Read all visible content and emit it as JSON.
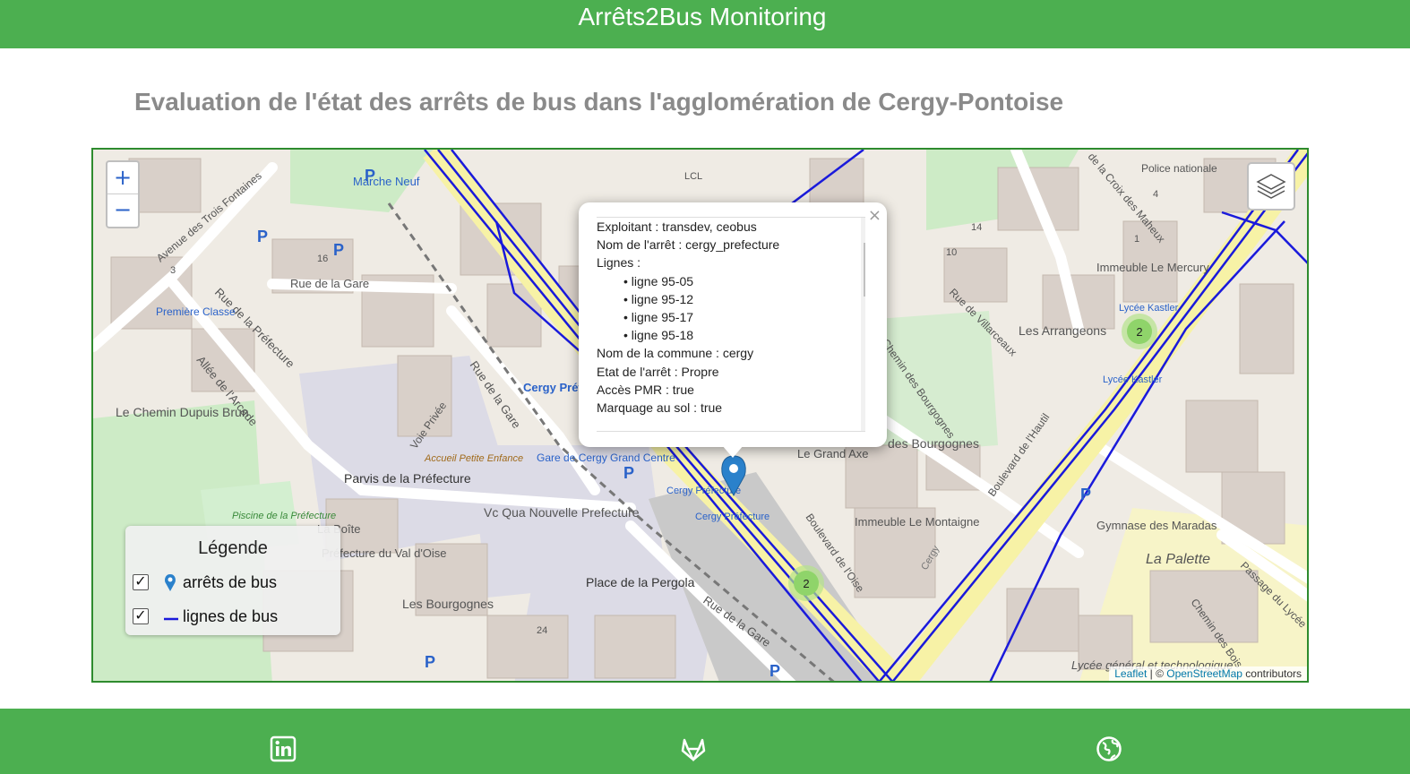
{
  "header": {
    "title": "Arrêts2Bus Monitoring"
  },
  "page": {
    "heading": "Evaluation de l'état des arrêts de bus dans l'agglomération de Cergy-Pontoise"
  },
  "map": {
    "zoom_in": "+",
    "zoom_out": "−",
    "labels": {
      "marche_neuf": "Marche Neuf",
      "lcl": "LCL",
      "police": "Police nationale",
      "rue_de_la_gare": "Rue de la Gare",
      "avenue_trois_fontaines": "Avenue des Trois Fontaines",
      "rue_prefecture": "Rue de la Préfecture",
      "premiere_classe": "Première Classe",
      "allee_arcade": "Allée de l'Arcade",
      "le_chemin_dupuis_brun": "Le Chemin Dupuis Brun",
      "parvis": "Parvis de la Préfecture",
      "voie_privee": "Voie Privée",
      "rue_de_la_gare_2": "Rue de la Gare",
      "cergy_prefecture": "Cergy Préfecture",
      "accueil": "Accueil Petite Enfance",
      "gare_cergy": "Gare de Cergy Grand Centre",
      "vc_qua": "Vc Qua Nouvelle Prefecture",
      "la_boite": "La Boîte",
      "prefecture_val_oise": "Préfecture du Val d'Oise",
      "piscine": "Piscine de la Préfecture",
      "les_bourgognes": "Les Bourgognes",
      "place_pergola": "Place de la Pergola",
      "rue_de_la_gare_3": "Rue de la Gare",
      "cergy_prefecture_stop1": "Cergy Préfecture",
      "cergy_prefecture_stop2": "Cergy Préfecture",
      "boulevard_oise": "Boulevard de l'Oise",
      "le_grand_axe": "Le Grand Axe",
      "immeuble_montaigne": "Immeuble Le Montaigne",
      "des_bourgognes": "des Bourgognes",
      "chemin_bourgognes": "Chemin des Bourgognes",
      "rue_villarceaux": "Rue de Villarceaux",
      "les_arrangeons": "Les Arrangeons",
      "immeuble_mercury": "Immeuble Le Mercury",
      "lycee_kastler": "Lycée Kastler",
      "lycee_kastler_2": "Lycée Kastler",
      "croix_maheux": "de la Croix des Maheux",
      "boulevard_hautil": "Boulevard de l'Hautil",
      "gymnase": "Gymnase des Maradas",
      "la_palette": "La Palette",
      "passage_lycee": "Passage du Lycée",
      "chemin_des_bois": "Chemin des Bois",
      "lycee_general": "Lycée général et technologique",
      "cergy": "Cergy",
      "num_16": "16",
      "num_14": "14",
      "num_10": "10",
      "num_24": "24",
      "num_3": "3",
      "num_4": "4",
      "num_1": "1"
    },
    "clusters": [
      "2",
      "2"
    ],
    "attribution": {
      "leaflet": "Leaflet",
      "sep": " | © ",
      "osm": "OpenStreetMap",
      "tail": " contributors"
    }
  },
  "popup": {
    "close": "×",
    "lines": [
      "Exploitant : transdev, ceobus",
      "Nom de l'arrêt : cergy_prefecture",
      "Lignes :"
    ],
    "lignes": [
      "• ligne 95-05",
      "• ligne 95-12",
      "• ligne 95-17",
      "• ligne 95-18"
    ],
    "details": [
      "Nom de la commune : cergy",
      "Etat de l'arrêt : Propre",
      "Accès PMR : true",
      "Marquage au sol : true"
    ]
  },
  "legend": {
    "title": "Légende",
    "items": [
      {
        "label": "arrêts de bus",
        "checked": true,
        "icon": "map-pin-icon"
      },
      {
        "label": "lignes de bus",
        "checked": true,
        "icon": "line-icon"
      }
    ]
  },
  "footer": {
    "icons": [
      "linkedin-icon",
      "gitlab-icon",
      "globe-icon"
    ]
  },
  "colors": {
    "brand_green": "#4caf50",
    "bus_line_blue": "#1a1adb",
    "marker_blue": "#2a81cb",
    "cluster_green": "#8fd46a"
  }
}
